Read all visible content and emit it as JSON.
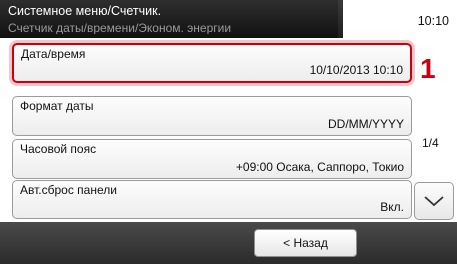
{
  "header": {
    "title": "Системное меню/Счетчик.",
    "subtitle": "Счетчик даты/времени/Эконом. энергии",
    "time": "10:10"
  },
  "list": {
    "items": [
      {
        "label": "Дата/время",
        "value": "10/10/2013 10:10",
        "selected": true
      },
      {
        "label": "Формат даты",
        "value": "DD/MM/YYYY",
        "selected": false
      },
      {
        "label": "Часовой пояс",
        "value": "+09:00 Осака, Саппоро, Токио",
        "selected": false
      },
      {
        "label": "Авт.сброс панели",
        "value": "Вкл.",
        "selected": false
      }
    ],
    "page_indicator": "1/4",
    "callout_number": "1"
  },
  "footer": {
    "back_label": "< Назад"
  },
  "colors": {
    "highlight": "#c8000f"
  },
  "icons": {
    "scroll_down": "chevron-down-icon"
  }
}
